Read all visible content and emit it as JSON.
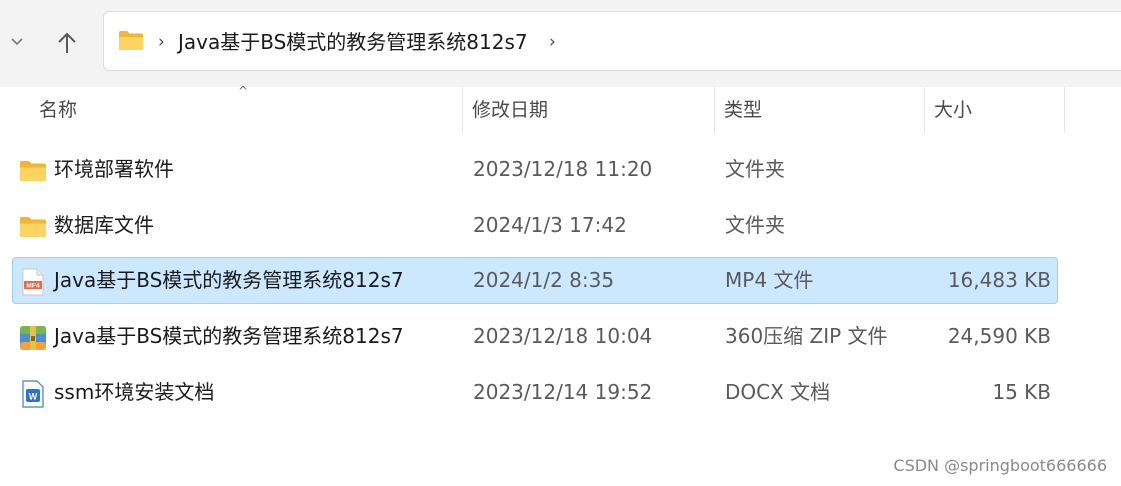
{
  "address": {
    "path": "Java基于BS模式的教务管理系统812s7"
  },
  "columns": {
    "name": "名称",
    "date": "修改日期",
    "type": "类型",
    "size": "大小"
  },
  "files": [
    {
      "name": "环境部署软件",
      "date": "2023/12/18 11:20",
      "type": "文件夹",
      "size": "",
      "icon": "folder-icon"
    },
    {
      "name": "数据库文件",
      "date": "2024/1/3 17:42",
      "type": "文件夹",
      "size": "",
      "icon": "folder-icon"
    },
    {
      "name": "Java基于BS模式的教务管理系统812s7",
      "date": "2024/1/2 8:35",
      "type": "MP4 文件",
      "size": "16,483 KB",
      "icon": "mp4-file-icon",
      "selected": true
    },
    {
      "name": "Java基于BS模式的教务管理系统812s7",
      "date": "2023/12/18 10:04",
      "type": "360压缩 ZIP 文件",
      "size": "24,590 KB",
      "icon": "zip-archive-icon"
    },
    {
      "name": "ssm环境安装文档",
      "date": "2023/12/14 19:52",
      "type": "DOCX 文档",
      "size": "15 KB",
      "icon": "docx-file-icon"
    }
  ],
  "watermark": "CSDN @springboot666666",
  "colors": {
    "selection_bg": "#cce8ff",
    "selection_border": "#99d1ff",
    "folder_yellow": "#f8c542"
  }
}
